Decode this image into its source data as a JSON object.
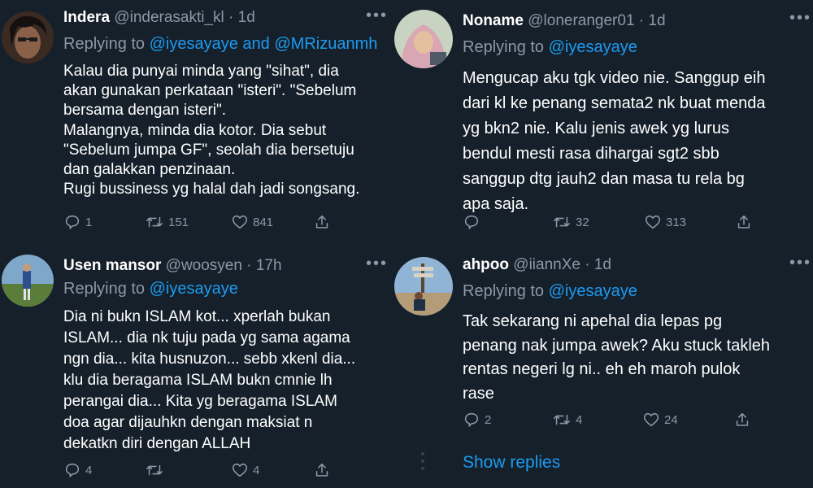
{
  "tweets": [
    {
      "name": "Indera",
      "handle": "@inderasakti_kl",
      "time": "1d",
      "replying_prefix": "Replying to",
      "replying_to": "@iyesayaye and @MRizuanmh",
      "text": "Kalau dia punyai minda yang \"sihat\", dia\nakan gunakan perkataan \"isteri\". \"Sebelum\nbersama dengan isteri\".\nMalangnya, minda dia kotor. Dia sebut\n\"Sebelum jumpa GF\", seolah dia bersetuju\ndan galakkan penzinaan.\nRugi bussiness yg halal dah jadi songsang.",
      "replies": "1",
      "retweets": "151",
      "likes": "841"
    },
    {
      "name": "Noname",
      "handle": "@loneranger01",
      "time": "1d",
      "replying_prefix": "Replying to",
      "replying_to": "@iyesayaye",
      "text": "Mengucap aku tgk video nie. Sanggup eih\ndari kl ke penang semata2 nk buat menda\nyg bkn2 nie. Kalu jenis awek yg lurus\nbendul mesti rasa dihargai sgt2 sbb\nsanggup dtg jauh2 dan masa tu rela bg\napa saja.",
      "replies": "",
      "retweets": "32",
      "likes": "313"
    },
    {
      "name": "Usen mansor",
      "handle": "@woosyen",
      "time": "17h",
      "replying_prefix": "Replying to",
      "replying_to": "@iyesayaye",
      "text": "Dia ni bukn ISLAM kot... xperlah bukan\nISLAM... dia nk tuju pada yg sama agama\nngn dia... kita husnuzon... sebb xkenl dia...\nklu dia beragama ISLAM bukn cmnie lh\nperangai dia... Kita yg beragama ISLAM\ndoa agar dijauhkn dengan maksiat n\ndekatkn diri dengan ALLAH",
      "replies": "4",
      "retweets": "",
      "likes": "4"
    },
    {
      "name": "ahpoo",
      "handle": "@iiannXe",
      "time": "1d",
      "replying_prefix": "Replying to",
      "replying_to": "@iyesayaye",
      "text": "Tak sekarang ni apehal dia lepas pg\npenang nak jumpa awek? Aku stuck takleh\nrentas negeri lg ni.. eh eh maroh pulok\nrase",
      "replies": "2",
      "retweets": "4",
      "likes": "24"
    }
  ],
  "show_replies_label": "Show replies",
  "icons": {
    "reply": "reply-icon",
    "retweet": "retweet-icon",
    "like": "heart-icon",
    "share": "share-icon",
    "more": "more-icon"
  },
  "colors": {
    "background": "#15202b",
    "text": "#ffffff",
    "muted": "#8b98a5",
    "link": "#1d9bf0",
    "divider": "#38444d"
  }
}
